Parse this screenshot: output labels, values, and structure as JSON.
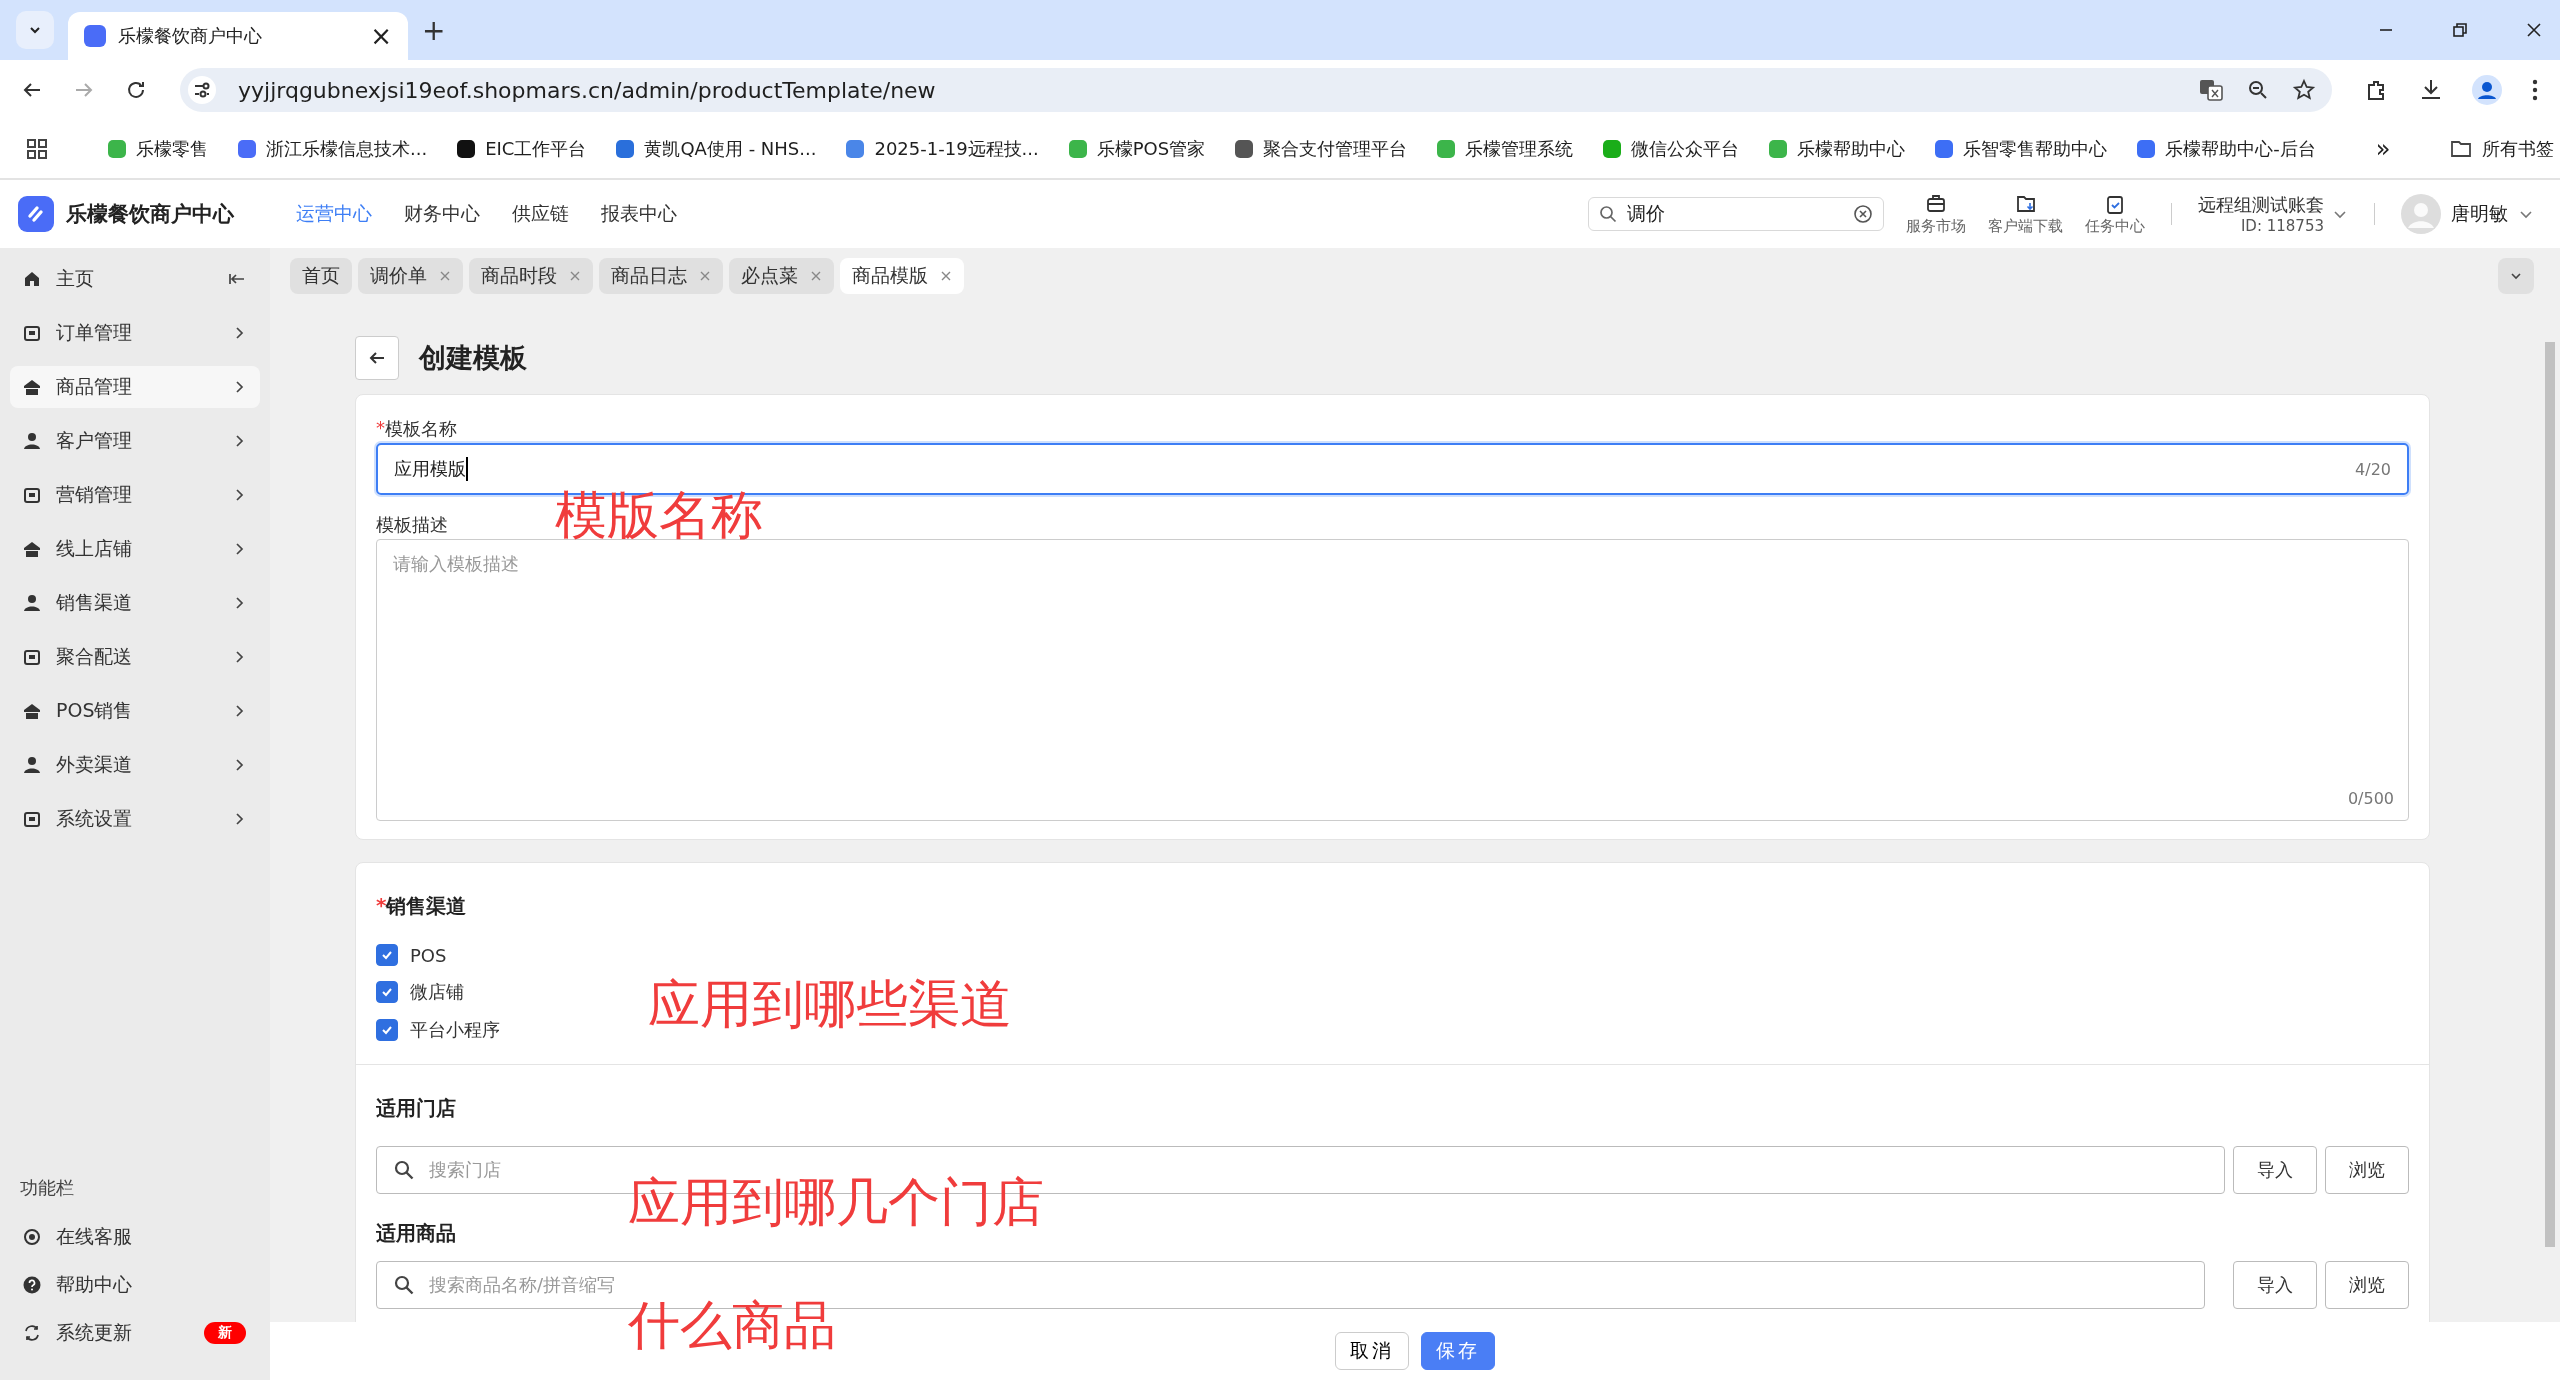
{
  "browser": {
    "tab": {
      "title": "乐檬餐饮商户中心",
      "close": "×"
    },
    "new_tab": "+",
    "address": "yyjjrqgubnexjsi19eof.shopmars.cn/admin/productTemplate/new",
    "bookmarks": [
      {
        "label": "乐檬零售"
      },
      {
        "label": "浙江乐檬信息技术..."
      },
      {
        "label": "EIC工作平台"
      },
      {
        "label": "黄凯QA使用 - NHS..."
      },
      {
        "label": "2025-1-19远程技..."
      },
      {
        "label": "乐檬POS管家"
      },
      {
        "label": "聚合支付管理平台"
      },
      {
        "label": "乐檬管理系统"
      },
      {
        "label": "微信公众平台"
      },
      {
        "label": "乐檬帮助中心"
      },
      {
        "label": "乐智零售帮助中心"
      },
      {
        "label": "乐檬帮助中心-后台"
      }
    ],
    "more": "»",
    "all_bookmarks": "所有书签"
  },
  "app": {
    "title": "乐檬餐饮商户中心",
    "nav": [
      {
        "label": "运营中心",
        "selected": true
      },
      {
        "label": "财务中心",
        "selected": false
      },
      {
        "label": "供应链",
        "selected": false
      },
      {
        "label": "报表中心",
        "selected": false
      }
    ],
    "search": {
      "value": "调价"
    },
    "tools": [
      {
        "label": "服务市场"
      },
      {
        "label": "客户端下载"
      },
      {
        "label": "任务中心"
      }
    ],
    "account": {
      "name": "远程组测试账套",
      "id": "ID: 118753"
    },
    "user": "唐明敏"
  },
  "sidebar": {
    "items": [
      {
        "label": "主页",
        "selected": false,
        "kind": "home"
      },
      {
        "label": "订单管理",
        "selected": false,
        "kind": "menu"
      },
      {
        "label": "商品管理",
        "selected": true,
        "kind": "menu"
      },
      {
        "label": "客户管理",
        "selected": false,
        "kind": "menu"
      },
      {
        "label": "营销管理",
        "selected": false,
        "kind": "menu"
      },
      {
        "label": "线上店铺",
        "selected": false,
        "kind": "menu"
      },
      {
        "label": "销售渠道",
        "selected": false,
        "kind": "menu"
      },
      {
        "label": "聚合配送",
        "selected": false,
        "kind": "menu"
      },
      {
        "label": "POS销售",
        "selected": false,
        "kind": "menu"
      },
      {
        "label": "外卖渠道",
        "selected": false,
        "kind": "menu"
      },
      {
        "label": "系统设置",
        "selected": false,
        "kind": "menu"
      }
    ],
    "footer_title": "功能栏",
    "footer_items": [
      {
        "label": "在线客服"
      },
      {
        "label": "帮助中心"
      },
      {
        "label": "系统更新",
        "badge": "新"
      }
    ]
  },
  "tags": [
    {
      "label": "首页",
      "selected": false,
      "closable": false
    },
    {
      "label": "调价单",
      "selected": false,
      "closable": true
    },
    {
      "label": "商品时段",
      "selected": false,
      "closable": true
    },
    {
      "label": "商品日志",
      "selected": false,
      "closable": true
    },
    {
      "label": "必点菜",
      "selected": false,
      "closable": true
    },
    {
      "label": "商品模版",
      "selected": true,
      "closable": true
    }
  ],
  "page": {
    "title": "创建模板",
    "name_field": {
      "mark": "*",
      "label": "模板名称",
      "value": "应用模版",
      "count": "4/20"
    },
    "desc_field": {
      "label": "模板描述",
      "placeholder": "请输入模板描述",
      "count": "0/500"
    },
    "channels": {
      "mark": "*",
      "title": "销售渠道",
      "options": [
        {
          "label": "POS",
          "checked": true
        },
        {
          "label": "微店铺",
          "checked": true
        },
        {
          "label": "平台小程序",
          "checked": true
        }
      ]
    },
    "stores": {
      "title": "适用门店",
      "placeholder": "搜索门店",
      "buttons": [
        "导入",
        "浏览"
      ]
    },
    "products": {
      "title": "适用商品",
      "placeholder": "搜索商品名称/拼音缩写",
      "buttons": [
        "导入",
        "浏览"
      ]
    },
    "actions": [
      {
        "label": "取消",
        "primary": false
      },
      {
        "label": "保存",
        "primary": true
      }
    ]
  },
  "annotations": [
    {
      "text": "模版名称"
    },
    {
      "text": "应用到哪些渠道"
    },
    {
      "text": "应用到哪几个门店"
    },
    {
      "text": "什么商品"
    }
  ]
}
